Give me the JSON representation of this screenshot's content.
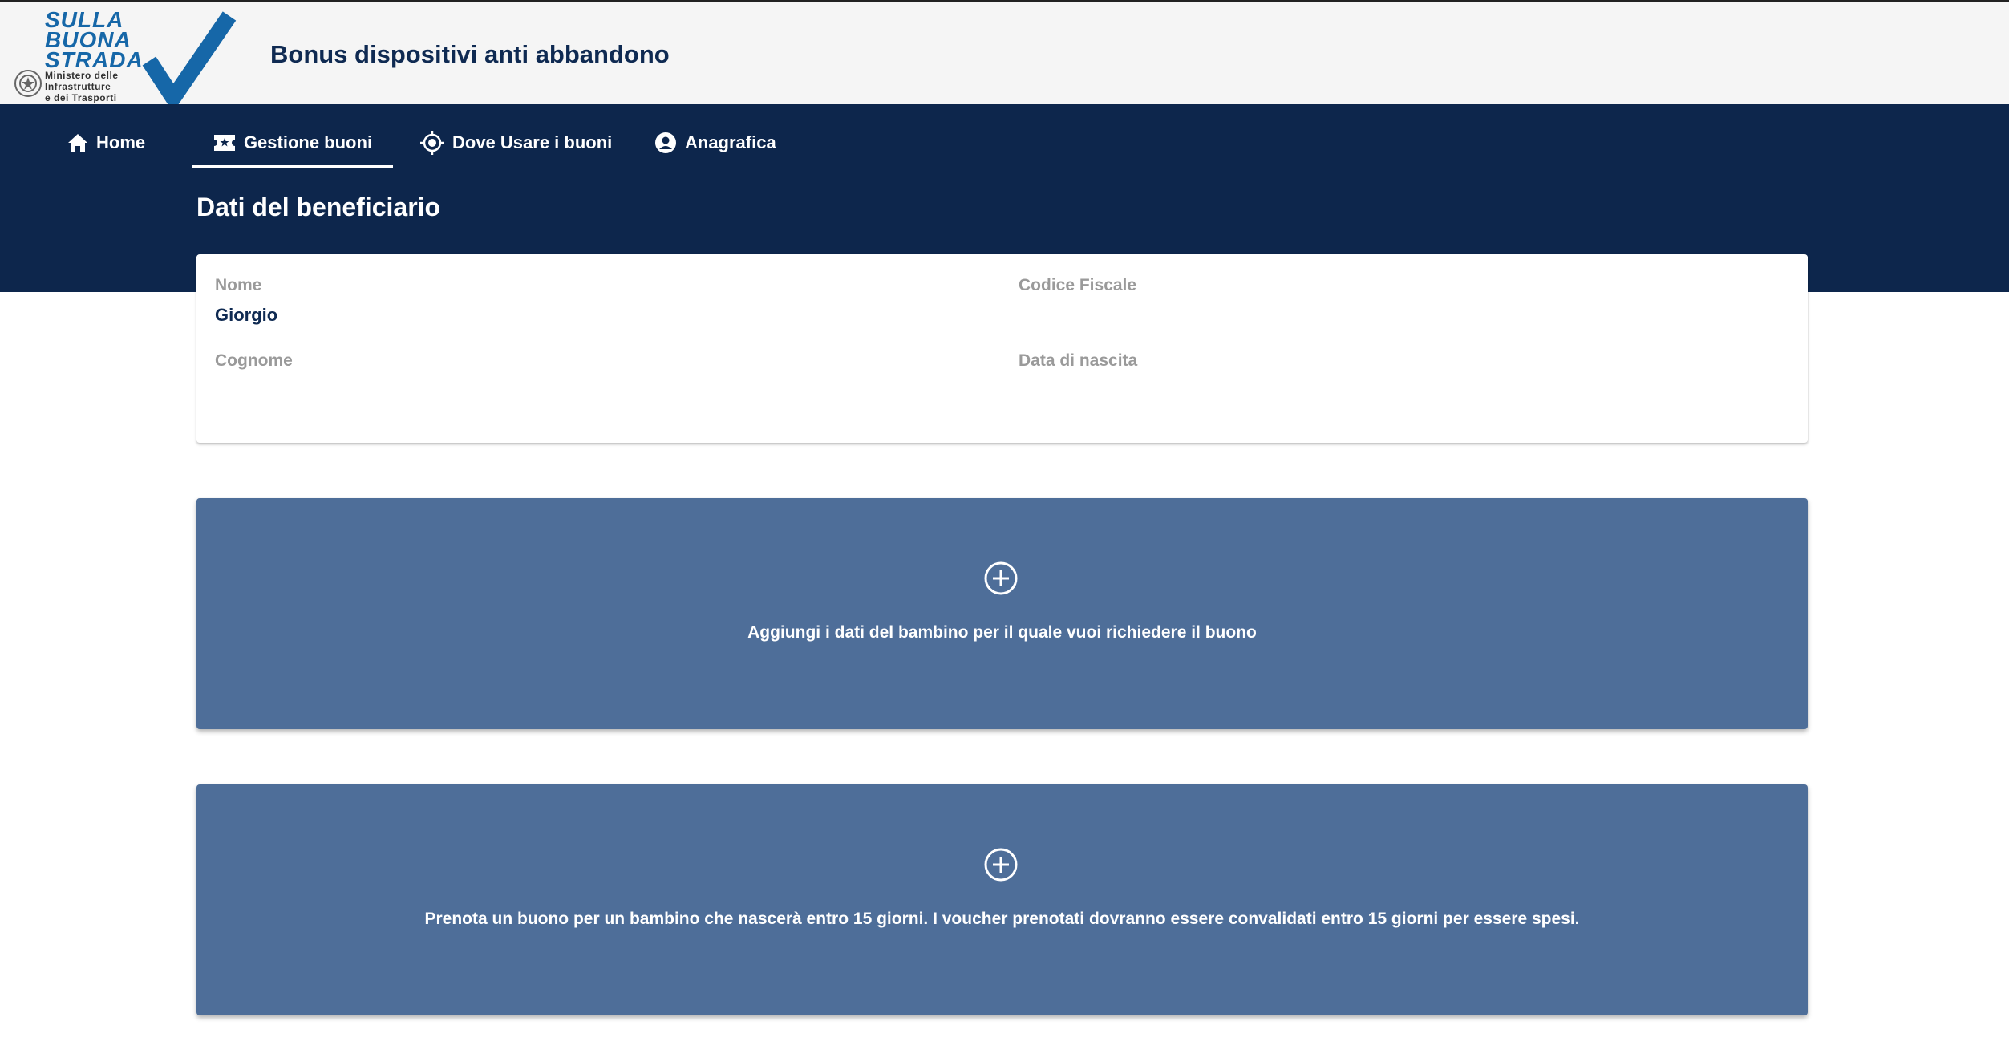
{
  "header": {
    "logo": {
      "line1": "SULLA",
      "line2": "BUONA",
      "line3": "STRADA",
      "ministry_line1": "Ministero delle",
      "ministry_line2": "Infrastrutture",
      "ministry_line3": "e dei Trasporti"
    },
    "app_title": "Bonus dispositivi anti abbandono"
  },
  "nav": {
    "items": [
      {
        "label": "Home",
        "icon": "home-icon"
      },
      {
        "label": "Gestione buoni",
        "icon": "ticket-icon",
        "active": true
      },
      {
        "label": "Dove Usare i buoni",
        "icon": "location-target-icon"
      },
      {
        "label": "Anagrafica",
        "icon": "user-circle-icon"
      }
    ]
  },
  "page_title": "Dati del beneficiario",
  "beneficiary": {
    "nome_label": "Nome",
    "nome_value": "Giorgio",
    "codice_fiscale_label": "Codice Fiscale",
    "codice_fiscale_value": "",
    "cognome_label": "Cognome",
    "cognome_value": "",
    "data_nascita_label": "Data di nascita",
    "data_nascita_value": ""
  },
  "actions": {
    "add_child": {
      "text": "Aggiungi i dati del bambino per il quale vuoi richiedere il buono",
      "icon": "plus-circle-icon"
    },
    "prenota": {
      "text": "Prenota un buono per un bambino che nascerà entro 15 giorni. I voucher prenotati dovranno essere convalidati entro 15 giorni per essere spesi.",
      "icon": "plus-circle-icon"
    }
  },
  "colors": {
    "navy": "#0d264c",
    "card_blue": "#4e6e99",
    "logo_blue": "#1667a8",
    "label_gray": "#9a9a9a"
  }
}
